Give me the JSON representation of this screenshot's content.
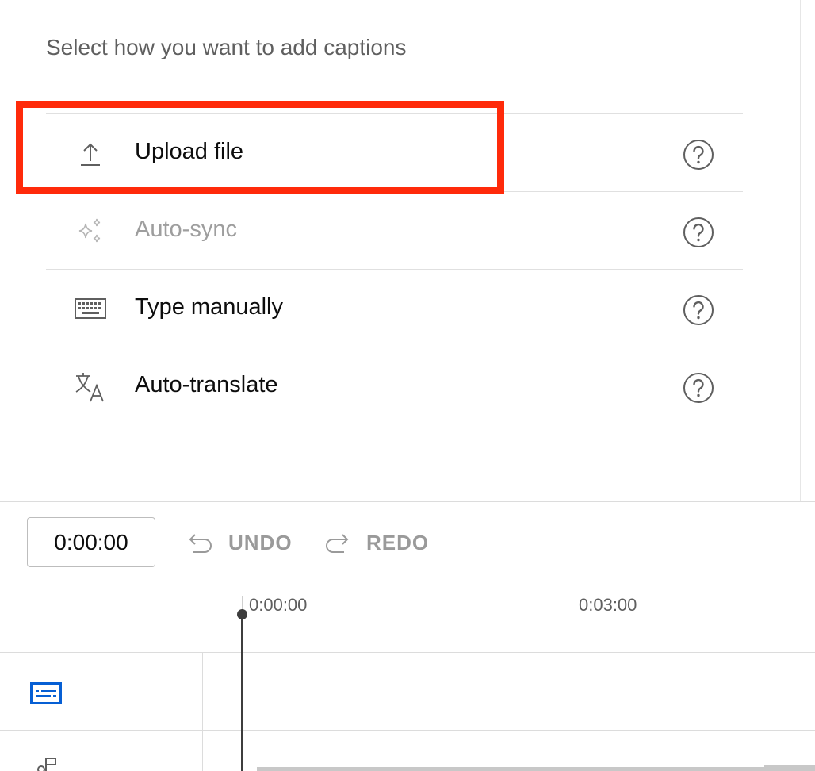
{
  "prompt": "Select how you want to add captions",
  "options": [
    {
      "label": "Upload file",
      "icon": "upload-icon",
      "disabled": false,
      "highlighted": true
    },
    {
      "label": "Auto-sync",
      "icon": "sparkle-icon",
      "disabled": true,
      "highlighted": false
    },
    {
      "label": "Type manually",
      "icon": "keyboard-icon",
      "disabled": false,
      "highlighted": false
    },
    {
      "label": "Auto-translate",
      "icon": "translate-icon",
      "disabled": false,
      "highlighted": false
    }
  ],
  "toolbar": {
    "timecode": "0:00:00",
    "undo_label": "UNDO",
    "redo_label": "REDO"
  },
  "timeline": {
    "ruler_labels": [
      "0:00:00",
      "0:03:00"
    ],
    "tracks": [
      {
        "icon": "captions-track-icon"
      },
      {
        "icon": "audio-track-icon"
      }
    ]
  },
  "colors": {
    "highlight": "#ff2a0a",
    "accent": "#065fd4",
    "disabled_text": "#9e9e9e"
  }
}
